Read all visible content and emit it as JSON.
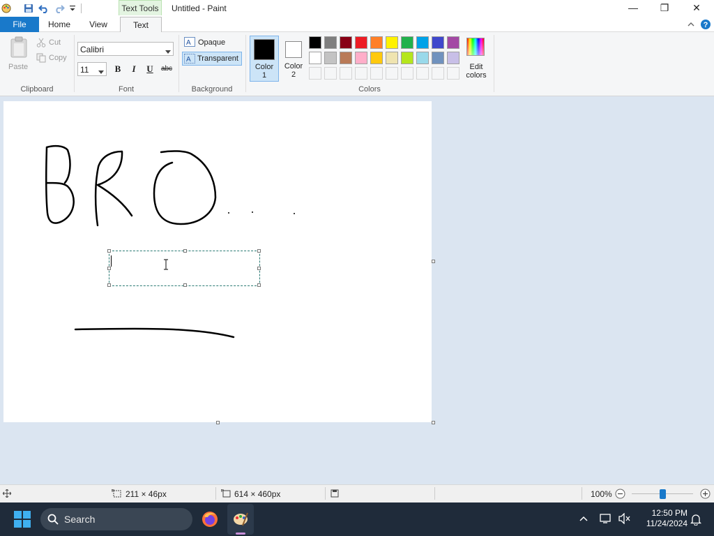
{
  "titlebar": {
    "context_tab": "Text Tools",
    "title": "Untitled - Paint",
    "minimize": "—",
    "maximize": "❐",
    "close": "✕"
  },
  "tabs": {
    "file": "File",
    "home": "Home",
    "view": "View",
    "text": "Text"
  },
  "ribbon": {
    "clipboard": {
      "paste": "Paste",
      "cut": "Cut",
      "copy": "Copy",
      "group_label": "Clipboard"
    },
    "font": {
      "family": "Calibri",
      "size": "11",
      "bold": "B",
      "italic": "I",
      "underline": "U",
      "strikethrough": "abc",
      "group_label": "Font"
    },
    "background": {
      "opaque": "Opaque",
      "transparent": "Transparent",
      "group_label": "Background"
    },
    "colors": {
      "color1_label": "Color\n1",
      "color2_label": "Color\n2",
      "color1_value": "#000000",
      "color2_value": "#ffffff",
      "edit_colors": "Edit\ncolors",
      "group_label": "Colors",
      "palette_row1": [
        "#000000",
        "#7f7f7f",
        "#880015",
        "#ed1c24",
        "#ff7f27",
        "#fff200",
        "#22b14c",
        "#00a2e8",
        "#3f48cc",
        "#a349a4"
      ],
      "palette_row2": [
        "#ffffff",
        "#c3c3c3",
        "#b97a57",
        "#ffaec9",
        "#ffc90e",
        "#efe4b0",
        "#b5e61d",
        "#99d9ea",
        "#7092be",
        "#c8bfe7"
      ]
    }
  },
  "canvas": {
    "drawing_text": "BRO",
    "background": "#ffffff"
  },
  "statusbar": {
    "selection_size": "211 × 46px",
    "image_size": "614 × 460px",
    "zoom": "100%"
  },
  "taskbar": {
    "search_placeholder": "Search",
    "time": "12:50 PM",
    "date": "11/24/2024"
  },
  "accent": "#1979ca"
}
